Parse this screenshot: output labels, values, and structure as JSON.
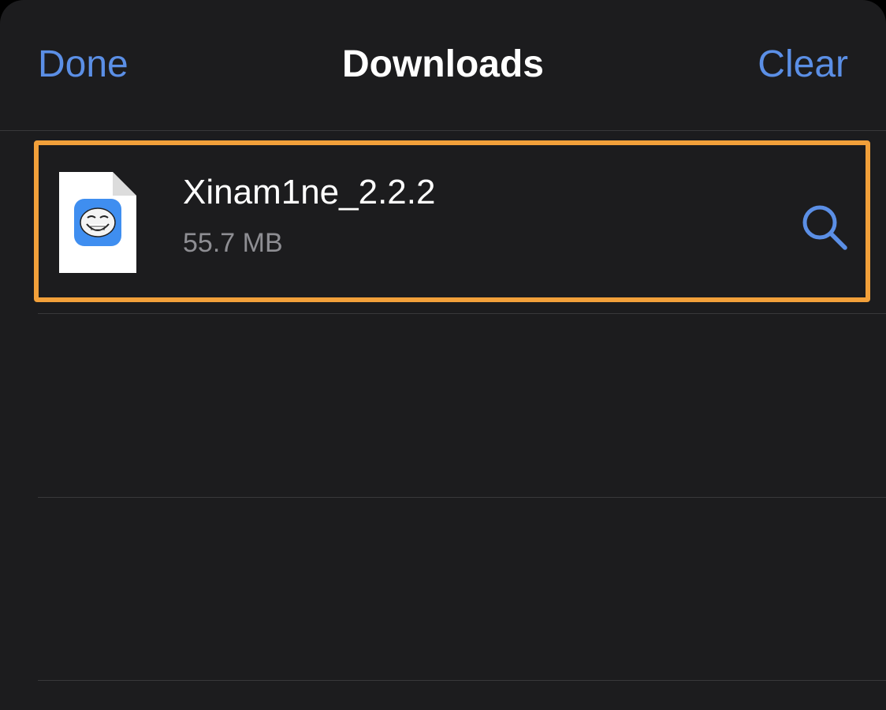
{
  "header": {
    "done_label": "Done",
    "title": "Downloads",
    "clear_label": "Clear"
  },
  "downloads": [
    {
      "name": "Xinam1ne_2.2.2",
      "size": "55.7 MB",
      "icon": "app-document-icon",
      "action_icon": "search-icon"
    }
  ],
  "colors": {
    "accent": "#5b8fe6",
    "highlight": "#f2a03a",
    "background": "#1c1c1e",
    "secondary_text": "#8e8e93"
  }
}
